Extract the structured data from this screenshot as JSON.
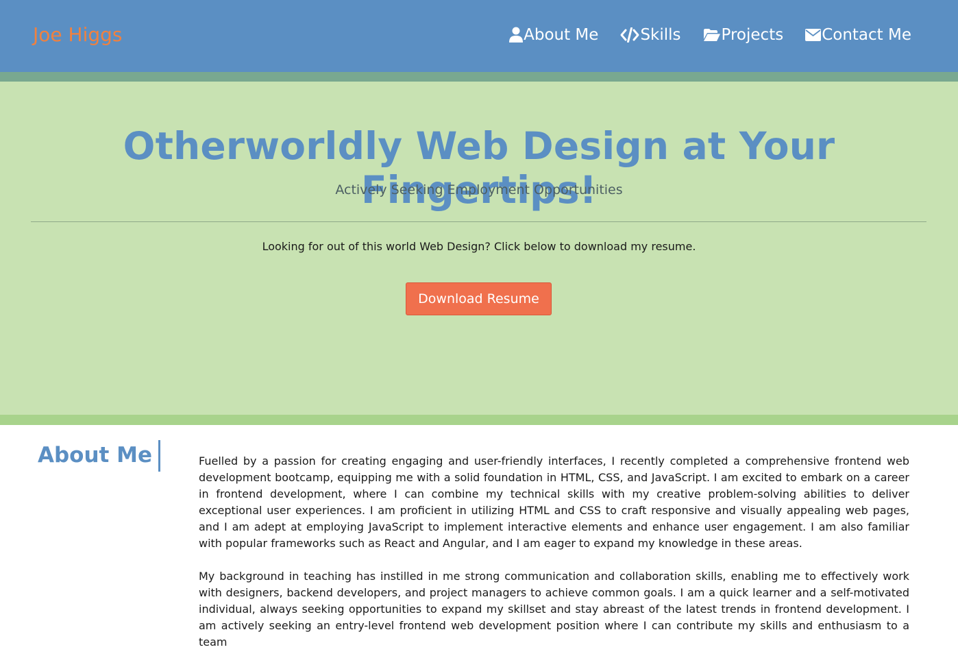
{
  "header": {
    "brand": "Joe Higgs",
    "nav": [
      {
        "label": "About Me",
        "icon": "user-icon"
      },
      {
        "label": "Skills",
        "icon": "code-icon"
      },
      {
        "label": "Projects",
        "icon": "folder-open-icon"
      },
      {
        "label": "Contact Me",
        "icon": "envelope-icon"
      }
    ]
  },
  "hero": {
    "title": "Otherworldly Web Design at Your Fingertips!",
    "subtitle": "Actively Seeking Employment Opportunities",
    "text": "Looking for out of this world Web Design? Click below to download my resume.",
    "button": "Download Resume"
  },
  "about": {
    "heading": "About Me",
    "paragraphs": [
      "Fuelled by a passion for creating engaging and user-friendly interfaces, I recently completed a comprehensive frontend web development bootcamp, equipping me with a solid foundation in HTML, CSS, and JavaScript. I am excited to embark on a career in frontend development, where I can combine my technical skills with my creative problem-solving abilities to deliver exceptional user experiences. I am proficient in utilizing HTML and CSS to craft responsive and visually appealing web pages, and I am adept at employing JavaScript to implement interactive elements and enhance user engagement. I am also familiar with popular frameworks such as React and Angular, and I am eager to expand my knowledge in these areas.",
      "My background in teaching has instilled in me strong communication and collaboration skills, enabling me to effectively work with designers, backend developers, and project managers to achieve common goals. I am a quick learner and a self-motivated individual, always seeking opportunities to expand my skillset and stay abreast of the latest trends in frontend development. I am actively seeking an entry-level frontend web development position where I can contribute my skills and enthusiasm to a team"
    ]
  },
  "colors": {
    "navbar": "#5b8fc3",
    "brand": "#f0813f",
    "hero_bg": "#c8e2b2",
    "band_dark": "#79a890",
    "band_light": "#a8d38c",
    "button": "#f0704d"
  }
}
